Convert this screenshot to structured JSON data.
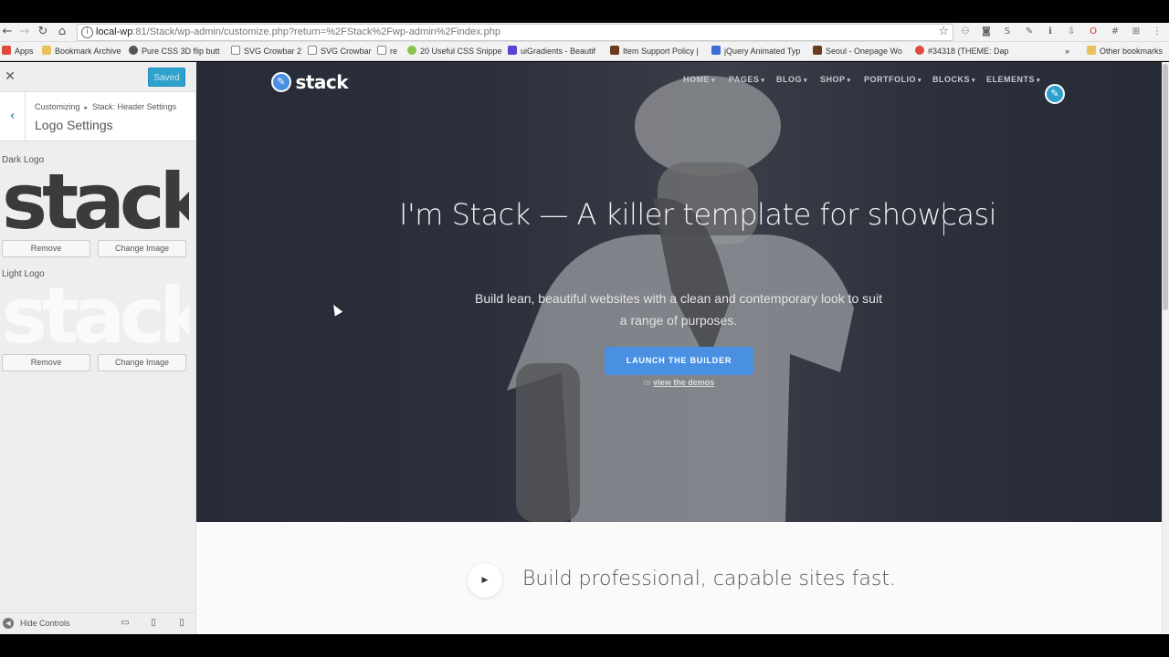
{
  "browser": {
    "url_host": "local-wp",
    "url_rest": ":81/Stack/wp-admin/customize.php?return=%2FStack%2Fwp-admin%2Findex.php",
    "bookmarks": [
      "Apps",
      "Bookmark Archive",
      "Pure CSS 3D flip butt",
      "SVG Crowbar 2",
      "SVG Crowbar",
      "re",
      "20 Useful CSS Snippe",
      "uiGradients - Beautif",
      "Item Support Policy |",
      "jQuery Animated Typ",
      "Seoul - Onepage Wo",
      "#34318 (THEME: Dap"
    ],
    "other_bookmarks": "Other bookmarks",
    "more": "»"
  },
  "customizer": {
    "saved_label": "Saved",
    "breadcrumb_root": "Customizing",
    "breadcrumb_sep": "▸",
    "breadcrumb_section": "Stack: Header Settings",
    "section_title": "Logo Settings",
    "dark_logo_label": "Dark Logo",
    "light_logo_label": "Light Logo",
    "logo_text": "stack",
    "remove_label": "Remove",
    "change_image_label": "Change Image",
    "hide_controls_label": "Hide Controls"
  },
  "site": {
    "logo_text": "stack",
    "menu": [
      "HOME",
      "PAGES",
      "BLOG",
      "SHOP",
      "PORTFOLIO",
      "BLOCKS",
      "ELEMENTS"
    ],
    "hero_title": "I'm Stack — A killer template for showcasi",
    "hero_sub": "Build lean, beautiful websites with a clean and contemporary look to suit a range of purposes.",
    "launch_label": "LAUNCH THE BUILDER",
    "or_text": "or ",
    "demos_link": "view the demos",
    "section_heading": "Build professional, capable sites fast."
  },
  "colors": {
    "accent_blue": "#4a90e2",
    "wp_blue": "#2ea2cc",
    "hero_bg": "#2c303c"
  }
}
